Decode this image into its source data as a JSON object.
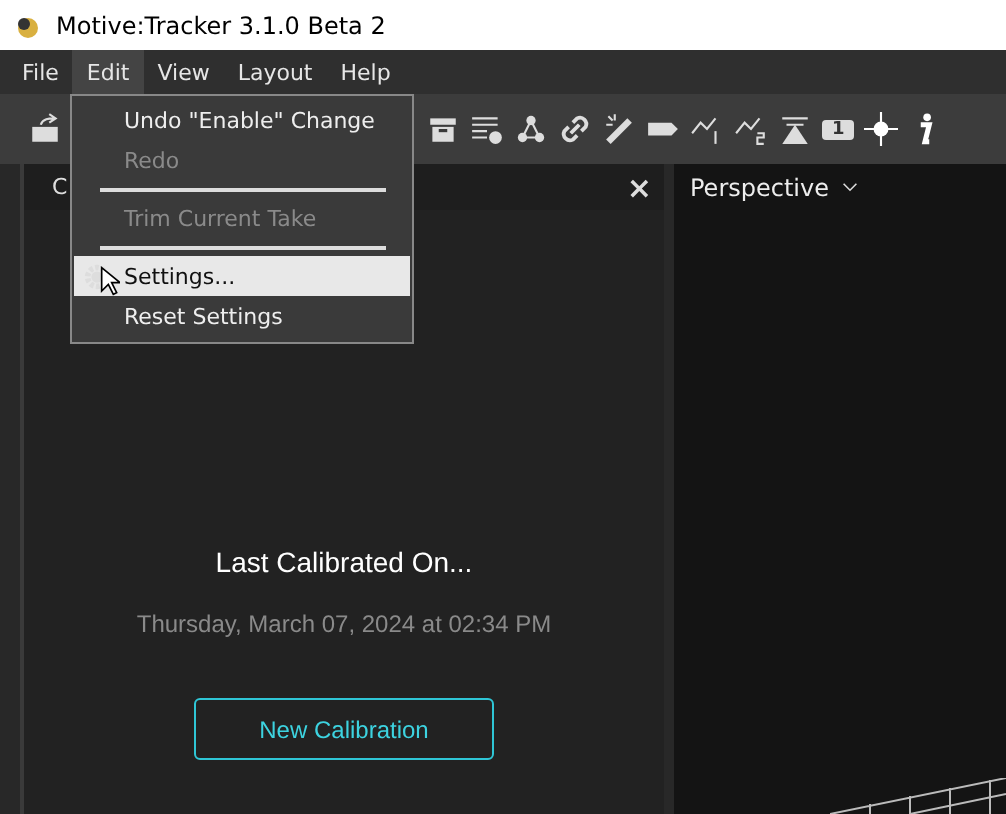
{
  "window": {
    "title": "Motive:Tracker 3.1.0 Beta 2"
  },
  "menubar": [
    {
      "label": "File",
      "selected": false
    },
    {
      "label": "Edit",
      "selected": true
    },
    {
      "label": "View",
      "selected": false
    },
    {
      "label": "Layout",
      "selected": false
    },
    {
      "label": "Help",
      "selected": false
    }
  ],
  "toolbar": {
    "badge": "1"
  },
  "edit_menu": [
    {
      "kind": "item",
      "label": "Undo \"Enable\" Change",
      "disabled": false,
      "selected": false
    },
    {
      "kind": "item",
      "label": "Redo",
      "disabled": true,
      "selected": false
    },
    {
      "kind": "separator"
    },
    {
      "kind": "item",
      "label": "Trim Current Take",
      "disabled": true,
      "selected": false
    },
    {
      "kind": "separator"
    },
    {
      "kind": "gearitem",
      "label": "Settings...",
      "disabled": false,
      "selected": true
    },
    {
      "kind": "item",
      "label": "Reset Settings",
      "disabled": false,
      "selected": false
    }
  ],
  "left_panel": {
    "tab": "C",
    "close": "×",
    "heading": "Last Calibrated On...",
    "date": "Thursday, March 07, 2024 at 02:34 PM",
    "button": "New Calibration"
  },
  "viewport": {
    "view": "Perspective"
  }
}
